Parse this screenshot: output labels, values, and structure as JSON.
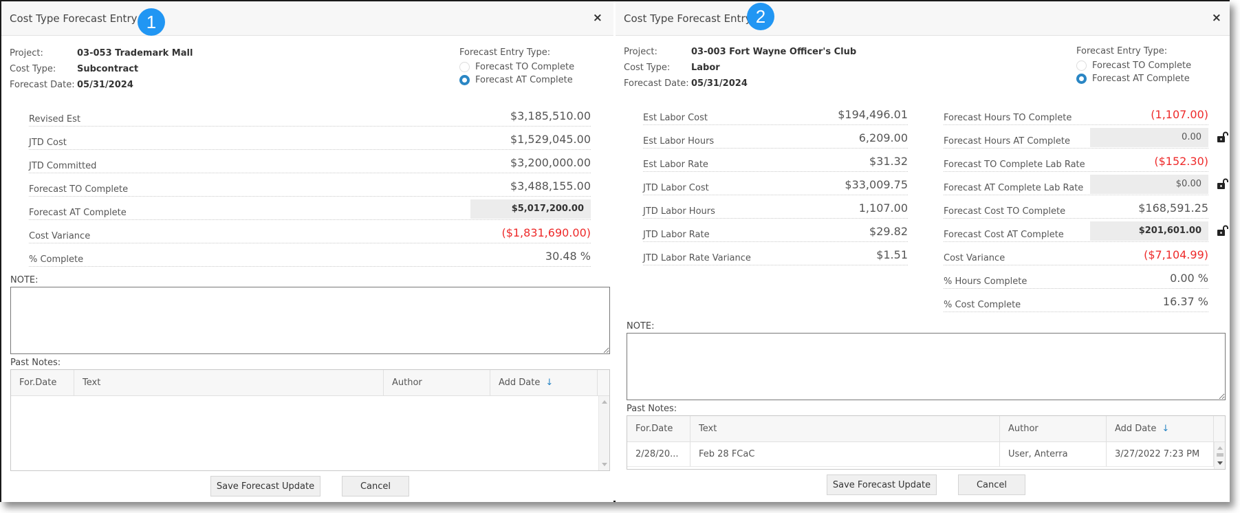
{
  "colors": {
    "accent": "#2a86c4",
    "badge": "#2196f3",
    "negative": "#ee2a2a",
    "readonly_box": "#ececec"
  },
  "panels": [
    {
      "badge": "1",
      "title": "Cost Type Forecast Entry",
      "close_icon": "×",
      "info": {
        "project_label": "Project:",
        "project_value": "03-053 Trademark Mall",
        "cost_type_label": "Cost Type:",
        "cost_type_value": "Subcontract",
        "forecast_date_label": "Forecast Date:",
        "forecast_date_value": "05/31/2024"
      },
      "entry_type": {
        "caption": "Forecast Entry Type:",
        "options": [
          "Forecast TO Complete",
          "Forecast AT Complete"
        ],
        "selected": "Forecast AT Complete"
      },
      "metrics": [
        {
          "label": "Revised Est",
          "value": "$3,185,510.00"
        },
        {
          "label": "JTD Cost",
          "value": "$1,529,045.00"
        },
        {
          "label": "JTD Committed",
          "value": "$3,200,000.00"
        },
        {
          "label": "Forecast TO Complete",
          "value": "$3,488,155.00"
        },
        {
          "label": "Forecast AT Complete",
          "value": "$5,017,200.00",
          "editable": true
        },
        {
          "label": "Cost Variance",
          "value": "($1,831,690.00)",
          "negative": true
        },
        {
          "label": "% Complete",
          "value": "30.48 %"
        }
      ],
      "note_label": "NOTE:",
      "note_value": "",
      "past_notes_label": "Past Notes:",
      "table": {
        "columns": [
          "For.Date",
          "Text",
          "Author",
          "Add Date"
        ],
        "sort_icon": "arrow-down-icon",
        "rows": []
      },
      "buttons": {
        "save": "Save Forecast Update",
        "cancel": "Cancel"
      }
    },
    {
      "badge": "2",
      "title": "Cost Type Forecast Entry",
      "close_icon": "×",
      "info": {
        "project_label": "Project:",
        "project_value": "03-003 Fort Wayne Officer's Club",
        "cost_type_label": "Cost Type:",
        "cost_type_value": "Labor",
        "forecast_date_label": "Forecast Date:",
        "forecast_date_value": "05/31/2024"
      },
      "entry_type": {
        "caption": "Forecast Entry Type:",
        "options": [
          "Forecast TO Complete",
          "Forecast AT Complete"
        ],
        "selected": "Forecast AT Complete"
      },
      "metrics_left": [
        {
          "label": "Est Labor Cost",
          "value": "$194,496.01"
        },
        {
          "label": "Est Labor Hours",
          "value": "6,209.00"
        },
        {
          "label": "Est Labor Rate",
          "value": "$31.32"
        },
        {
          "label": "JTD Labor Cost",
          "value": "$33,009.75"
        },
        {
          "label": "JTD Labor Hours",
          "value": "1,107.00"
        },
        {
          "label": "JTD Labor Rate",
          "value": "$29.82"
        },
        {
          "label": "JTD Labor Rate Variance",
          "value": "$1.51"
        }
      ],
      "metrics_right": [
        {
          "label": "Forecast Hours TO Complete",
          "value": "(1,107.00)",
          "negative": true
        },
        {
          "label": "Forecast Hours AT Complete",
          "value": "0.00",
          "editable": true,
          "lock": "unlocked"
        },
        {
          "label": "Forecast TO Complete Lab Rate",
          "value": "($152.30)",
          "negative": true
        },
        {
          "label": "Forecast AT Complete Lab Rate",
          "value": "$0.00",
          "editable": true,
          "lock": "unlocked"
        },
        {
          "label": "Forecast Cost TO Complete",
          "value": "$168,591.25"
        },
        {
          "label": "Forecast Cost AT Complete",
          "value": "$201,601.00",
          "editable": true,
          "bold": true,
          "lock": "unlocked"
        },
        {
          "label": "Cost Variance",
          "value": "($7,104.99)",
          "negative": true
        },
        {
          "label": "% Hours Complete",
          "value": "0.00 %"
        },
        {
          "label": "% Cost Complete",
          "value": "16.37 %"
        }
      ],
      "note_label": "NOTE:",
      "note_value": "",
      "past_notes_label": "Past Notes:",
      "table": {
        "columns": [
          "For.Date",
          "Text",
          "Author",
          "Add Date"
        ],
        "sort_icon": "arrow-down-icon",
        "rows": [
          {
            "for_date": "2/28/20...",
            "text": "Feb 28 FCaC",
            "author": "User, Anterra",
            "add_date": "3/27/2022 7:23 PM"
          }
        ]
      },
      "buttons": {
        "save": "Save Forecast Update",
        "cancel": "Cancel"
      }
    }
  ]
}
